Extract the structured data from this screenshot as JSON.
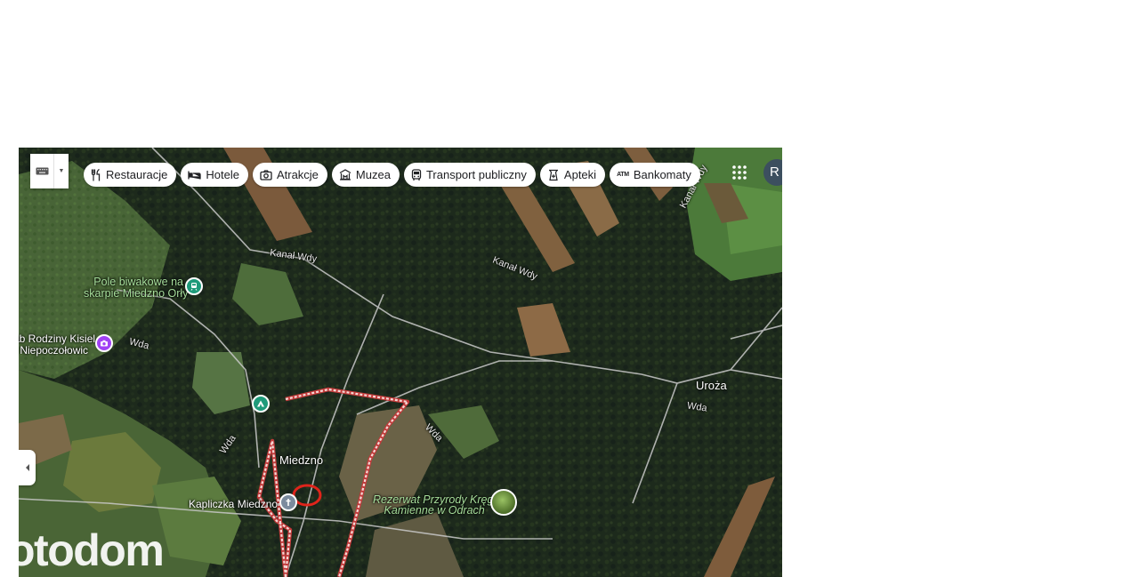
{
  "colors": {
    "plot_boundary": "#f4d8d5",
    "marker_ring": "#e0241b",
    "green_poi": "#1e9a7a",
    "purple_poi": "#a142f4",
    "cemetery_poi": "#7b8b9e",
    "road": "#c9c9c9",
    "river_label": "#e8e8e8"
  },
  "toolbar": {
    "keyboard_icon": "keyboard-icon",
    "dropdown_icon": "caret-down-icon"
  },
  "categories": [
    {
      "label": "Restauracje",
      "icon": "fork-knife-icon"
    },
    {
      "label": "Hotele",
      "icon": "bed-icon"
    },
    {
      "label": "Atrakcje",
      "icon": "camera-icon"
    },
    {
      "label": "Muzea",
      "icon": "museum-icon"
    },
    {
      "label": "Transport publiczny",
      "icon": "bus-icon"
    },
    {
      "label": "Apteki",
      "icon": "pharmacy-icon"
    },
    {
      "label": "Bankomaty",
      "icon": "atm-icon",
      "glyph": "ATM"
    }
  ],
  "account": {
    "initial": "R"
  },
  "places": {
    "town_miedzno": "Miedzno",
    "town_uroza": "Uroża",
    "chapel": "Kapliczka Miedzno",
    "campsite_line1": "Pole biwakowe na",
    "campsite_line2": "skarpie Miedzno Orły",
    "farm_line1": "ab Rodziny Kisiel",
    "farm_line2": "r Niepoczołowic",
    "reserve_line1": "Rezerwat Przyrody Kręgi",
    "reserve_line2": "Kamienne w Odrach"
  },
  "waterways": {
    "canal_1": "Kanał Wdy",
    "canal_2": "Kanał Wdy",
    "canal_3": "Kanał Wdy",
    "river_1": "Wda",
    "river_2": "Wda",
    "river_3": "Wda",
    "river_4": "Wda"
  },
  "watermark": "otodom"
}
